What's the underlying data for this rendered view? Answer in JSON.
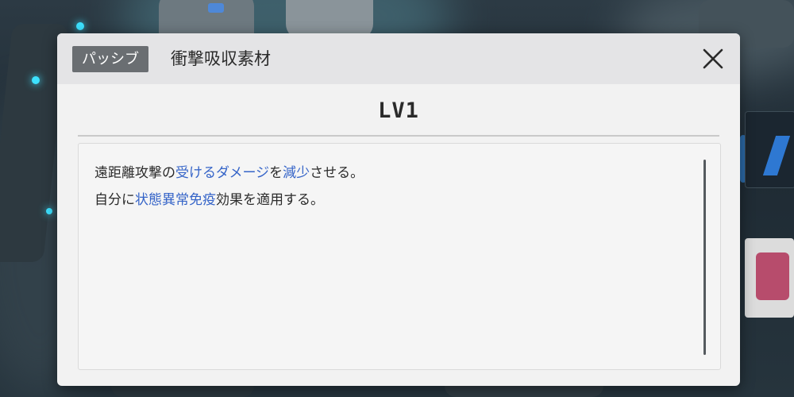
{
  "dialog": {
    "badge": "パッシブ",
    "title": "衝撃吸収素材",
    "level": "LV1",
    "description": [
      [
        {
          "text": "遠距離攻撃の",
          "highlight": false
        },
        {
          "text": "受けるダメージ",
          "highlight": true
        },
        {
          "text": "を",
          "highlight": false
        },
        {
          "text": "減少",
          "highlight": true
        },
        {
          "text": "させる。",
          "highlight": false
        }
      ],
      [
        {
          "text": "自分に",
          "highlight": false
        },
        {
          "text": "状態異常免疫",
          "highlight": true
        },
        {
          "text": "効果を適用する。",
          "highlight": false
        }
      ]
    ],
    "close_icon": "close-icon"
  },
  "colors": {
    "highlight": "#3564c8",
    "badge_bg": "#6a6e72",
    "titlebar_bg": "#e4e4e6",
    "panel_bg": "#f2f2f2"
  }
}
